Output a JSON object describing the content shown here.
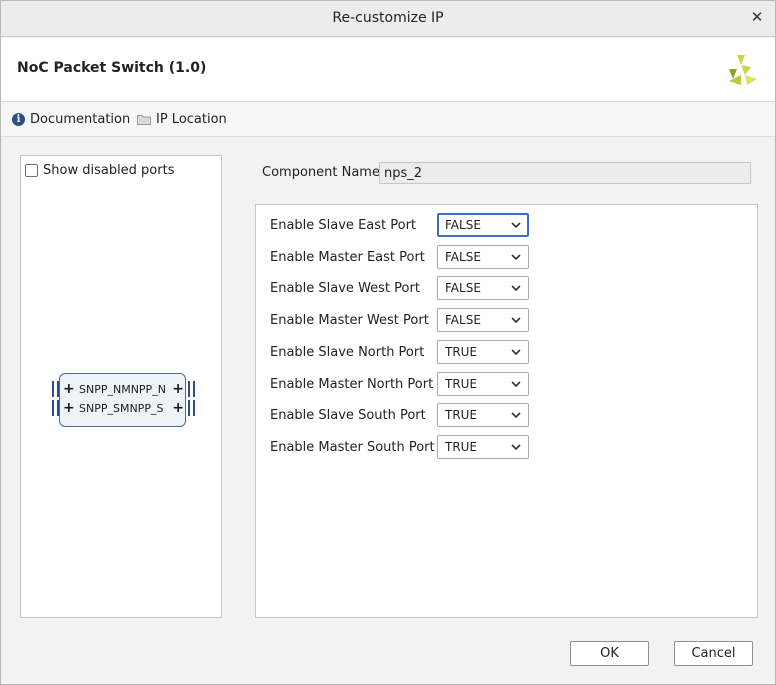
{
  "window": {
    "title": "Re-customize IP"
  },
  "header": {
    "ip_title": "NoC Packet Switch (1.0)"
  },
  "links": {
    "documentation": "Documentation",
    "ip_location": "IP Location"
  },
  "left_panel": {
    "show_disabled_ports": "Show disabled ports",
    "ports": [
      "SNPP_NMNPP_N",
      "SNPP_SMNPP_S"
    ]
  },
  "component": {
    "label": "Component Name",
    "value": "nps_2"
  },
  "params": [
    {
      "label": "Enable Slave East Port",
      "value": "FALSE"
    },
    {
      "label": "Enable Master East Port",
      "value": "FALSE"
    },
    {
      "label": "Enable Slave West Port",
      "value": "FALSE"
    },
    {
      "label": "Enable Master West Port",
      "value": "FALSE"
    },
    {
      "label": "Enable Slave North Port",
      "value": "TRUE"
    },
    {
      "label": "Enable Master North Port",
      "value": "TRUE"
    },
    {
      "label": "Enable Slave South Port",
      "value": "TRUE"
    },
    {
      "label": "Enable Master South Port",
      "value": "TRUE"
    }
  ],
  "buttons": {
    "ok": "OK",
    "cancel": "Cancel"
  },
  "colors": {
    "accent": "#3b6fc1",
    "port_bus": "#2b4f86",
    "logo_light": "#c8d64a",
    "logo_dark": "#8ea02a"
  },
  "icons": [
    "close-icon",
    "xilinx-logo",
    "info-icon",
    "folder-icon",
    "chevron-down-icon",
    "plus-icon"
  ]
}
